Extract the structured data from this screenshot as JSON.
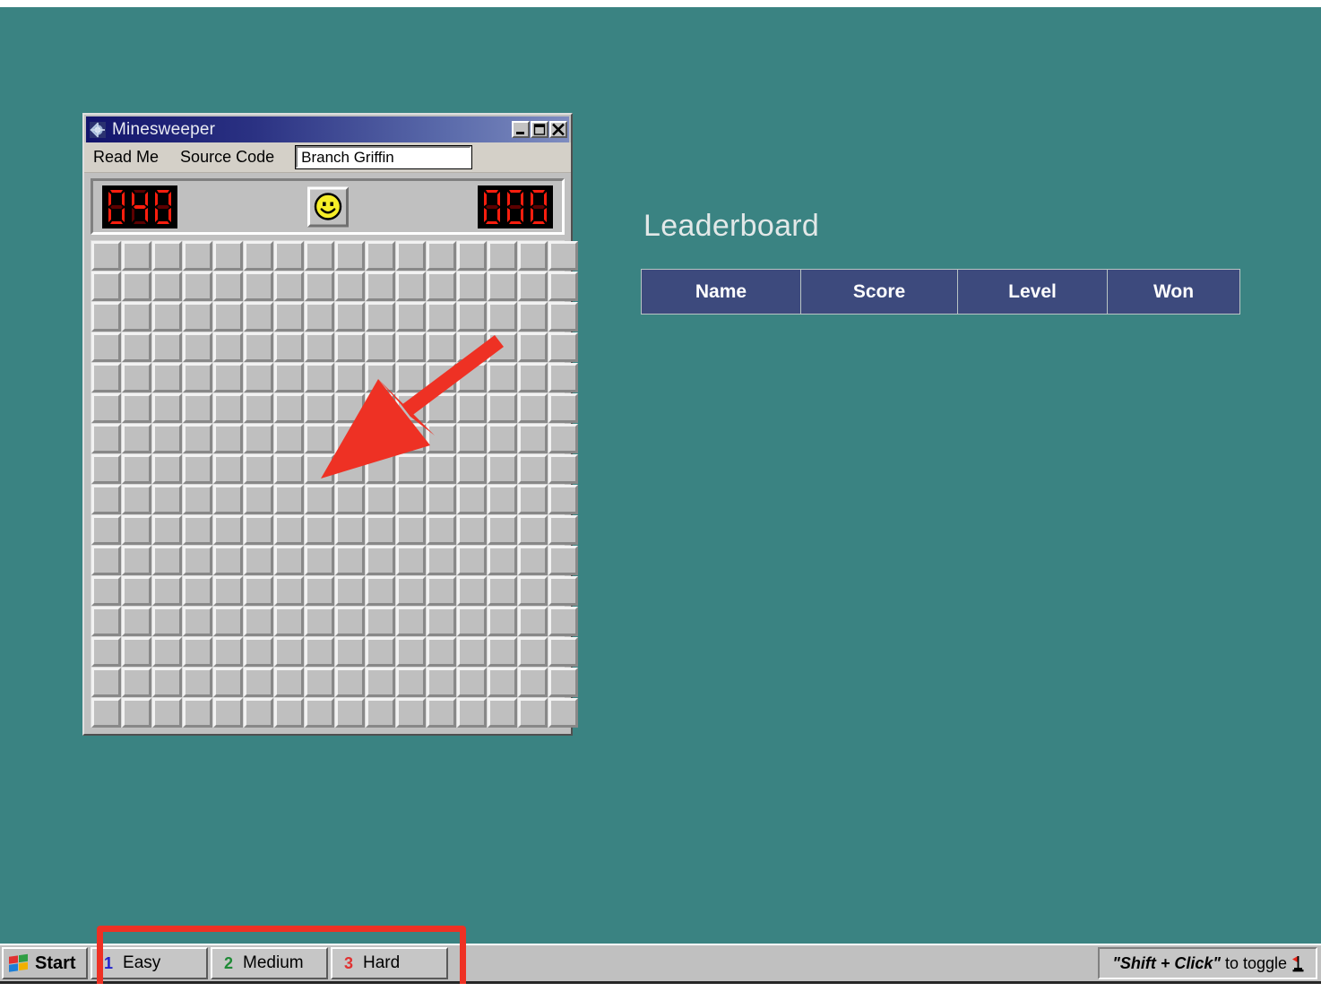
{
  "desktop": {
    "background_color": "#3a8382"
  },
  "window": {
    "title": "Minesweeper",
    "icon": "minesweeper-mine-icon",
    "controls": {
      "minimize": "minimize-icon",
      "maximize": "maximize-icon",
      "close": "close-icon"
    },
    "menu": [
      {
        "label": "Read Me"
      },
      {
        "label": "Source Code"
      }
    ],
    "name_field": {
      "value": "Branch Griffin",
      "placeholder": ""
    },
    "status": {
      "mine_counter": "040",
      "timer": "000",
      "face": "smiley-face"
    },
    "board": {
      "rows": 16,
      "cols": 16,
      "cell_state": "covered"
    }
  },
  "leaderboard": {
    "title": "Leaderboard",
    "columns": [
      "Name",
      "Score",
      "Level",
      "Won"
    ],
    "rows": [],
    "header_color": "#3d4a7d"
  },
  "annotation": {
    "arrow_color": "#ee3124",
    "highlight_box_color": "#ee3124"
  },
  "taskbar": {
    "start": {
      "label": "Start",
      "icon": "windows-flag-icon"
    },
    "buttons": [
      {
        "num": "1",
        "label": "Easy",
        "color": "#2222cc"
      },
      {
        "num": "2",
        "label": "Medium",
        "color": "#1f8a36"
      },
      {
        "num": "3",
        "label": "Hard",
        "color": "#e03131"
      }
    ],
    "tray": {
      "quoted": "\"Shift + Click\"",
      "suffix": " to toggle ",
      "icon": "flag-icon"
    }
  }
}
